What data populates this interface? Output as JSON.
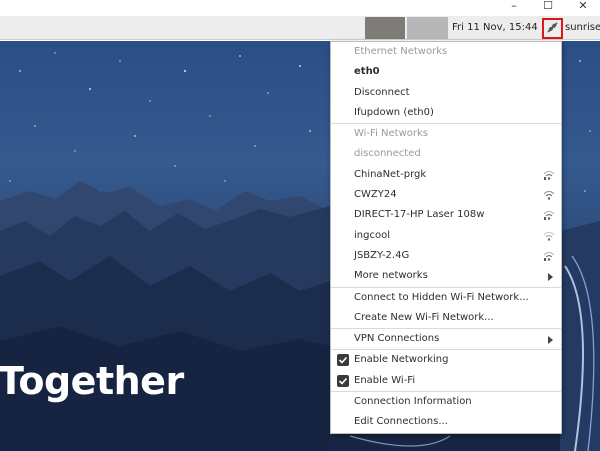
{
  "window_controls": {
    "minimize": "–",
    "maximize": "☐",
    "close": "✕"
  },
  "panel": {
    "clock": "Fri 11 Nov, 15:44",
    "user": "sunrise",
    "network_icon": "network-wired-icon"
  },
  "wallpaper": {
    "text": "Together"
  },
  "menu": {
    "ethernet_header": "Ethernet Networks",
    "eth_device": "eth0",
    "disconnect": "Disconnect",
    "ifupdown": "Ifupdown (eth0)",
    "wifi_header": "Wi-Fi Networks",
    "wifi_status": "disconnected",
    "networks": [
      {
        "ssid": "ChinaNet-prgk",
        "icon": "wifi-signal-icon"
      },
      {
        "ssid": "CWZY24",
        "icon": "wifi-signal-icon"
      },
      {
        "ssid": "DIRECT-17-HP Laser 108w",
        "icon": "wifi-signal-icon"
      },
      {
        "ssid": "ingcool",
        "icon": "wifi-signal-icon"
      },
      {
        "ssid": "JSBZY-2.4G",
        "icon": "wifi-signal-icon"
      }
    ],
    "more_networks": "More networks",
    "connect_hidden": "Connect to Hidden Wi-Fi Network...",
    "create_new": "Create New Wi-Fi Network...",
    "vpn": "VPN Connections",
    "enable_networking": "Enable Networking",
    "enable_networking_checked": true,
    "enable_wifi": "Enable Wi-Fi",
    "enable_wifi_checked": true,
    "connection_info": "Connection Information",
    "edit_connections": "Edit Connections..."
  }
}
